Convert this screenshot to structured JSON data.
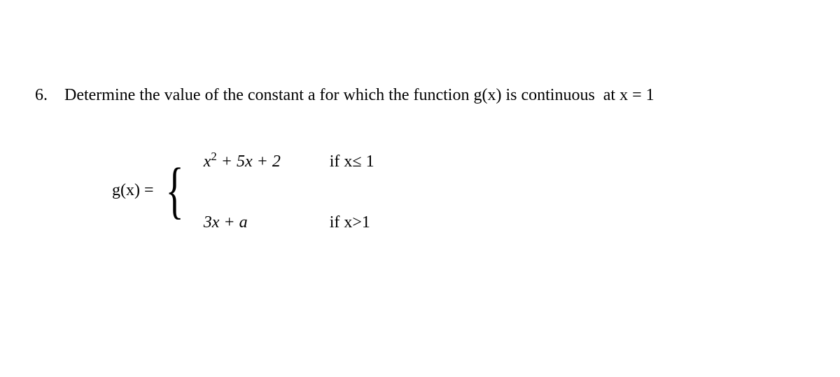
{
  "problem": {
    "number": "6.",
    "text": "Determine the value of the constant a for which the function g(x) is continuous  at x = 1"
  },
  "function": {
    "name": "g(x) =",
    "cases": [
      {
        "expression_html": "x² + 5x + 2",
        "condition": "if x≤ 1"
      },
      {
        "expression_html": "3x + a",
        "condition": "if x>1"
      }
    ]
  }
}
